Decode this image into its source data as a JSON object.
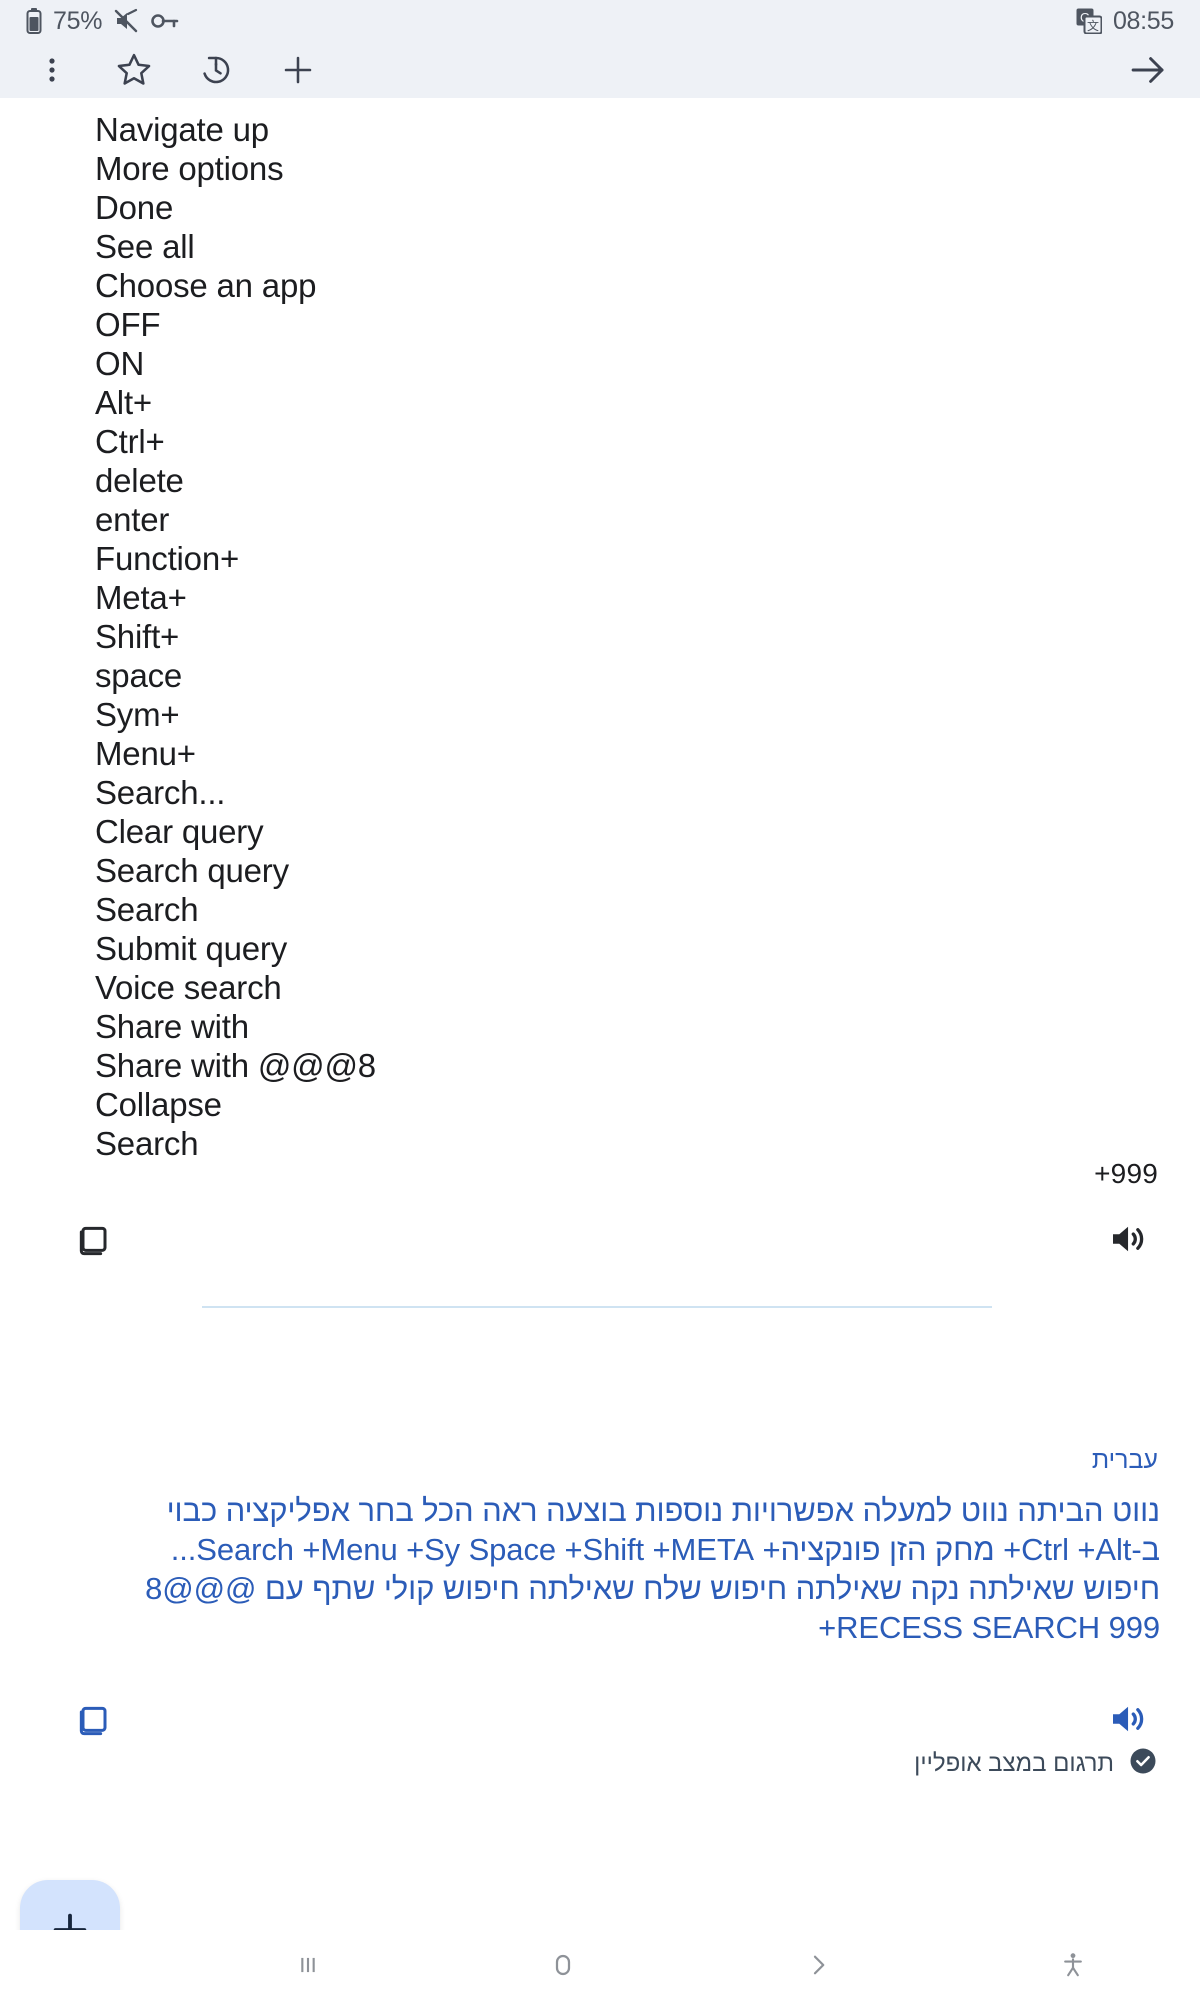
{
  "status_bar": {
    "battery_text": "75%",
    "time": "08:55",
    "icons": [
      "battery-icon",
      "mute-icon",
      "key-icon",
      "google-translate-icon"
    ]
  },
  "toolbar": {
    "buttons": [
      {
        "name": "more-options-button",
        "icon": "three-dot-menu-icon"
      },
      {
        "name": "saved-button",
        "icon": "star-icon"
      },
      {
        "name": "history-button",
        "icon": "history-icon"
      },
      {
        "name": "new-translation-button",
        "icon": "plus-icon"
      }
    ],
    "submit_icon": "arrow-right-icon"
  },
  "source": {
    "lines": [
      "Navigate up",
      "More options",
      "Done",
      "See all",
      "Choose an app",
      "OFF",
      "ON",
      "Alt+",
      "Ctrl+",
      "delete",
      "enter",
      "Function+",
      "Meta+",
      "Shift+",
      "space",
      "Sym+",
      "Menu+",
      "Search...",
      "Clear query",
      "Search query",
      "Search",
      "Submit query",
      "Voice search",
      "Share with",
      "Share with @@@8",
      "Collapse",
      "Search"
    ],
    "overflow_count": "+999",
    "copy_label": "copy-icon",
    "speak_label": "speaker-icon"
  },
  "translation": {
    "language_label": "עברית",
    "lines": [
      "נווט הביתה נווט למעלה אפשרויות נוספות בוצעה ראה הכל בחר אפליקציה כבוי",
      "ב-Ctrl +Alt+ מחק הזן פונקציה+ Search +Menu +Sy Space +Shift +META...",
      "חיפוש שאילתה נקה שאילתה חיפוש שלח שאילתה חיפוש קולי שתף עם @@@8",
      "RECESS SEARCH 999+"
    ],
    "copy_label": "copy-icon",
    "speak_label": "speaker-icon",
    "offline_note": "תרגום במצב אופליין",
    "offline_icon": "download-done-icon",
    "accent_color": "#2b5cb8"
  },
  "fab": {
    "label": "+",
    "name": "add-button",
    "color": "#d3e3fd"
  },
  "nav_bar": {
    "items": [
      {
        "name": "recents-button",
        "icon": "recents-icon"
      },
      {
        "name": "home-button",
        "icon": "home-icon"
      },
      {
        "name": "back-button",
        "icon": "chevron-right-icon"
      },
      {
        "name": "accessibility-button",
        "icon": "accessibility-icon"
      }
    ]
  }
}
